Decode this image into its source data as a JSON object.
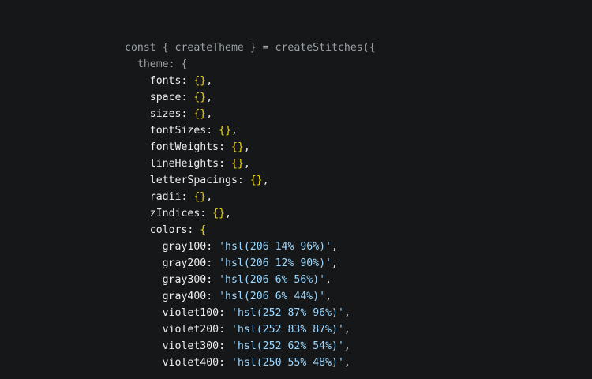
{
  "code": {
    "line1": "const { createTheme } = createStitches({",
    "line2": "  theme: {",
    "scale_keys": [
      {
        "key": "fonts",
        "value": "{}"
      },
      {
        "key": "space",
        "value": "{}"
      },
      {
        "key": "sizes",
        "value": "{}"
      },
      {
        "key": "fontSizes",
        "value": "{}"
      },
      {
        "key": "fontWeights",
        "value": "{}"
      },
      {
        "key": "lineHeights",
        "value": "{}"
      },
      {
        "key": "letterSpacings",
        "value": "{}"
      },
      {
        "key": "radii",
        "value": "{}"
      },
      {
        "key": "zIndices",
        "value": "{}"
      }
    ],
    "colors_key": "colors",
    "colors_open": "{",
    "colors": [
      {
        "key": "gray100",
        "value": "'hsl(206 14% 96%)'"
      },
      {
        "key": "gray200",
        "value": "'hsl(206 12% 90%)'"
      },
      {
        "key": "gray300",
        "value": "'hsl(206 6% 56%)'"
      },
      {
        "key": "gray400",
        "value": "'hsl(206 6% 44%)'"
      },
      {
        "key": "violet100",
        "value": "'hsl(252 87% 96%)'"
      },
      {
        "key": "violet200",
        "value": "'hsl(252 83% 87%)'"
      },
      {
        "key": "violet300",
        "value": "'hsl(252 62% 54%)'"
      },
      {
        "key": "violet400",
        "value": "'hsl(250 55% 48%)'"
      }
    ]
  },
  "colors_theme": {
    "background": "#151718",
    "keyword": "#9ba1a6",
    "property": "#ecedee",
    "brace": "#f5d90a",
    "string": "#9ed8ff"
  }
}
